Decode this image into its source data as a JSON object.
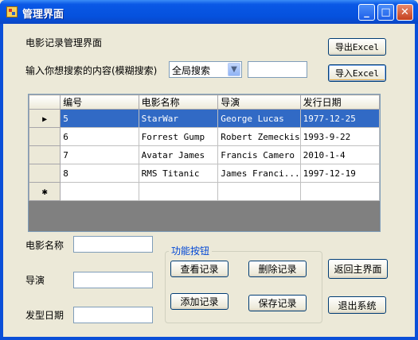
{
  "window": {
    "title": "管理界面",
    "minimize_glyph": "_",
    "maximize_glyph": "□",
    "close_glyph": "✕"
  },
  "header": {
    "heading": "电影记录管理界面"
  },
  "search": {
    "label": "输入你想搜索的内容(模糊搜索)",
    "scope_selected": "全局搜索",
    "keyword_value": ""
  },
  "toolbar": {
    "export_label": "导出Excel",
    "import_label": "导入Excel"
  },
  "grid": {
    "columns": [
      "编号",
      "电影名称",
      "导演",
      "发行日期"
    ],
    "rows": [
      [
        "5",
        "StarWar",
        "George Lucas",
        "1977-12-25"
      ],
      [
        "6",
        "Forrest Gump",
        "Robert Zemeckis",
        "1993-9-22"
      ],
      [
        "7",
        "Avatar James",
        "Francis Camero",
        "2010-1-4"
      ],
      [
        "8",
        "RMS Titanic",
        "James Franci...",
        "1997-12-19"
      ]
    ],
    "current_row_marker": "▶",
    "new_row_marker": "✱"
  },
  "form": {
    "name_label": "电影名称",
    "director_label": "导演",
    "date_label": "发型日期",
    "name_value": "",
    "director_value": "",
    "date_value": ""
  },
  "function_group": {
    "legend": "功能按钮",
    "view_label": "查看记录",
    "delete_label": "删除记录",
    "add_label": "添加记录",
    "save_label": "保存记录"
  },
  "nav": {
    "return_label": "返回主界面",
    "exit_label": "退出系统"
  },
  "colors": {
    "titlebar": "#0551dd",
    "selection": "#316ac5",
    "grid_background": "#808080",
    "form_background": "#ece9d8",
    "group_legend": "#0046d5"
  }
}
